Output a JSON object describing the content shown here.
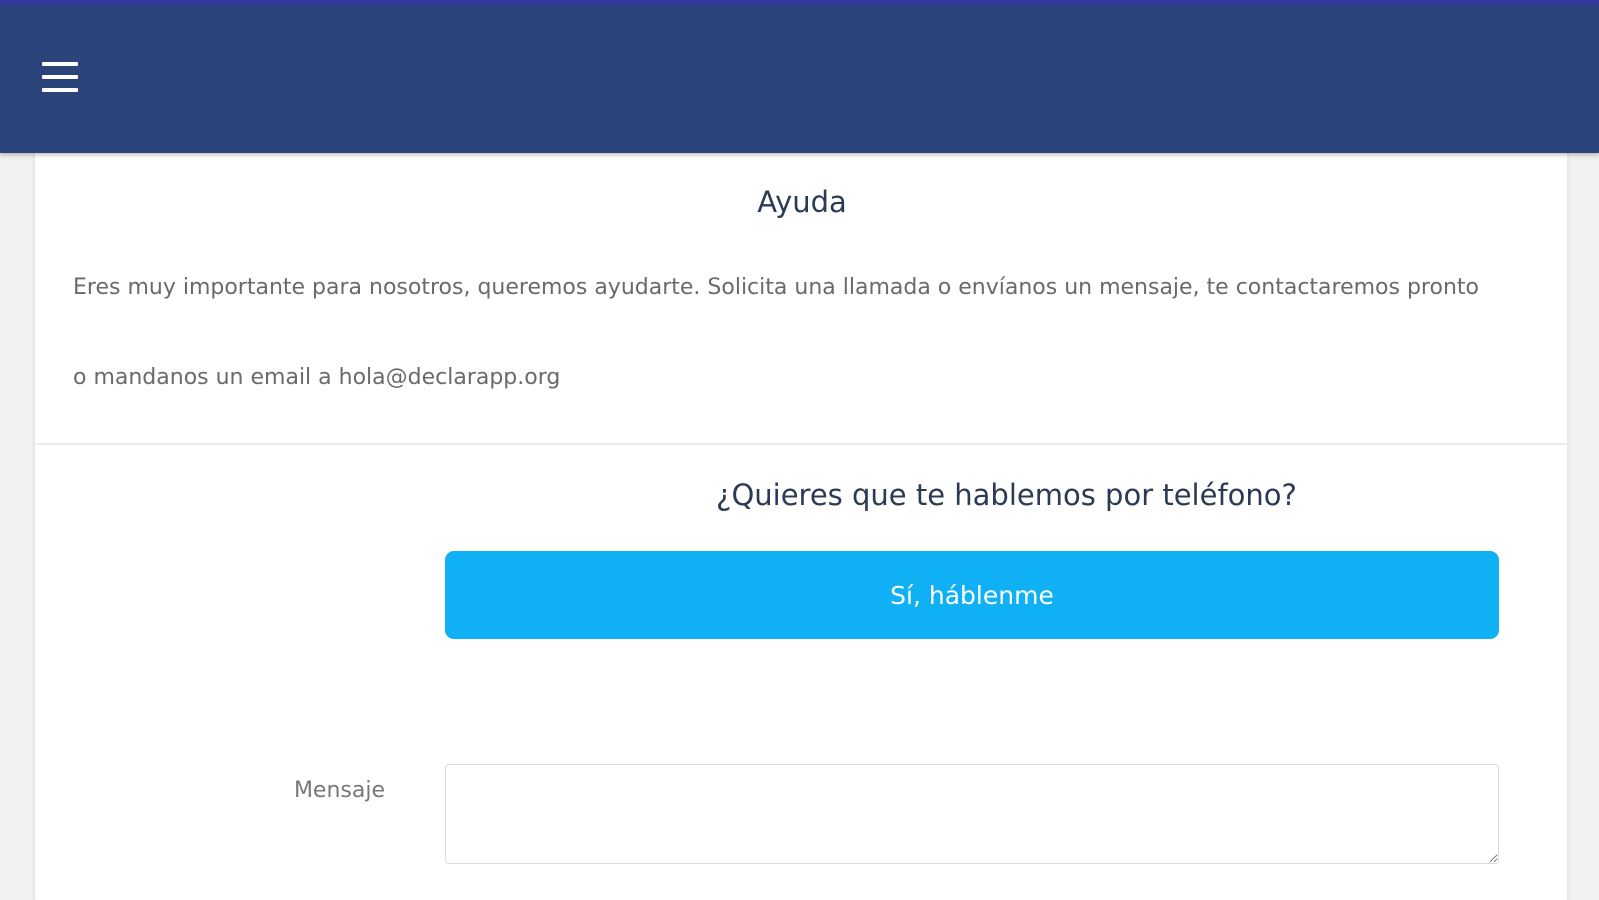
{
  "header": {
    "menu_icon": "hamburger-menu-icon",
    "background_color": "#2b4479",
    "accent_border_color": "#33369a"
  },
  "help": {
    "title": "Ayuda",
    "text_line_1": "Eres muy importante para nosotros, queremos ayudarte. Solicita una llamada o envíanos un mensaje, te contactaremos pronto",
    "text_line_2": "o mandanos un email a hola@declarapp.org"
  },
  "phone": {
    "question": "¿Quieres que te hablemos por teléfono?",
    "button_label": "Sí, háblenme",
    "button_color": "#10b0f5"
  },
  "message": {
    "label": "Mensaje",
    "value": ""
  }
}
